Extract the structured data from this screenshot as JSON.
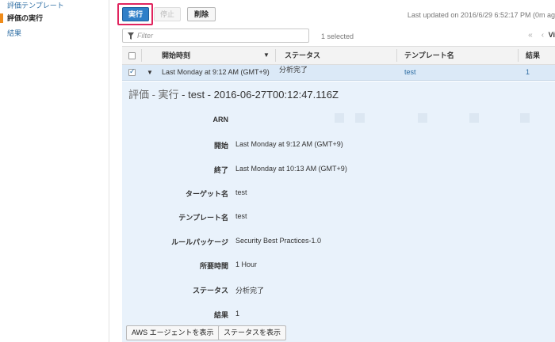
{
  "sidebar": {
    "items": [
      {
        "label": "評価テンプレート",
        "active": false
      },
      {
        "label": "評価の実行",
        "active": true
      },
      {
        "label": "結果",
        "active": false
      }
    ]
  },
  "toolbar": {
    "run_label": "実行",
    "stop_label": "停止",
    "delete_label": "削除",
    "last_updated": "Last updated on 2016/6/29 6:52:17 PM (0m ag"
  },
  "filter": {
    "placeholder": "Filter",
    "selected_text": "1 selected",
    "pager_first": "«",
    "pager_prev": "‹",
    "pager_label": "Vi"
  },
  "table": {
    "headers": [
      "開始時刻",
      "ステータス",
      "テンプレート名",
      "結果"
    ],
    "rows": [
      {
        "start": "Last Monday at 9:12 AM (GMT+9)",
        "status": "分析完了",
        "template": "test",
        "result": "1",
        "selected": true
      }
    ]
  },
  "detail": {
    "title_prefix": "評価 - 実行",
    "title_main": " - test - 2016-06-27T00:12:47.116Z",
    "fields": [
      {
        "label": "ARN",
        "value": ""
      },
      {
        "label": "開始",
        "value": "Last Monday at 9:12 AM (GMT+9)"
      },
      {
        "label": "終了",
        "value": "Last Monday at 10:13 AM (GMT+9)"
      },
      {
        "label": "ターゲット名",
        "value": "test"
      },
      {
        "label": "テンプレート名",
        "value": "test"
      },
      {
        "label": "ルールパッケージ",
        "value": "Security Best Practices-1.0"
      },
      {
        "label": "所要時間",
        "value": "1 Hour"
      },
      {
        "label": "ステータス",
        "value": "分析完了"
      },
      {
        "label": "結果",
        "value": "1"
      }
    ],
    "buttons": {
      "show_agents": "AWS エージェントを表示",
      "show_status": "ステータスを表示"
    }
  },
  "colors": {
    "primary": "#2f7fc8",
    "highlight": "#e0245e",
    "sidebar_active": "#f08c1a",
    "selected_row": "#dbe9f7",
    "detail_bg": "#e9f2fb"
  }
}
